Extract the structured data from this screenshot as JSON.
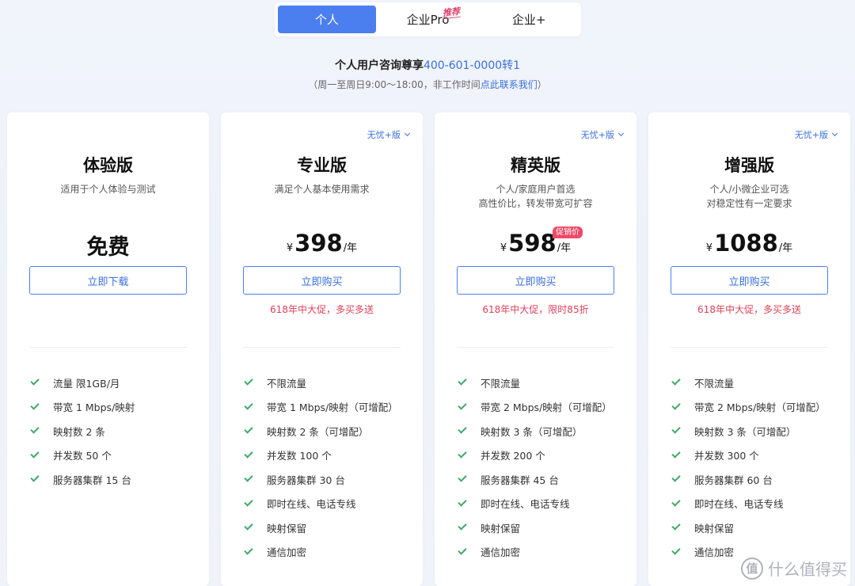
{
  "tabs": [
    {
      "label": "个人",
      "active": true
    },
    {
      "label": "企业Pro",
      "tag": "推荐"
    },
    {
      "label": "企业+"
    }
  ],
  "contact": {
    "text": "个人用户咨询尊享",
    "phone": "400-601-0000转1",
    "hours": "（周一至周日9:00～18:00，非工作时间",
    "link": "点此联系我们",
    "close": "）"
  },
  "plans": [
    {
      "variant": "",
      "title": "体验版",
      "desc": [
        "适用于个人体验与测试"
      ],
      "free_text": "免费",
      "currency": "",
      "amount": "",
      "unit": "",
      "badge": "",
      "button": "立即下载",
      "promo": "",
      "features": [
        "流量 限1GB/月",
        "带宽 1 Mbps/映射",
        "映射数 2 条",
        "并发数 50 个",
        "服务器集群 15 台"
      ]
    },
    {
      "variant": "无忧+版",
      "title": "专业版",
      "desc": [
        "满足个人基本使用需求"
      ],
      "free_text": "",
      "currency": "¥",
      "amount": "398",
      "unit": "/年",
      "badge": "",
      "button": "立即购买",
      "promo": "618年中大促，多买多送",
      "features": [
        "不限流量",
        "带宽 1 Mbps/映射（可增配）",
        "映射数 2 条（可增配）",
        "并发数 100 个",
        "服务器集群 30 台",
        "即时在线、电话专线",
        "映射保留",
        "通信加密"
      ]
    },
    {
      "variant": "无忧+版",
      "title": "精英版",
      "desc": [
        "个人/家庭用户首选",
        "高性价比，转发带宽可扩容"
      ],
      "free_text": "",
      "currency": "¥",
      "amount": "598",
      "unit": "/年",
      "badge": "促销价",
      "button": "立即购买",
      "promo": "618年中大促，限时85折",
      "features": [
        "不限流量",
        "带宽 2 Mbps/映射（可增配）",
        "映射数 3 条（可增配）",
        "并发数 200 个",
        "服务器集群 45 台",
        "即时在线、电话专线",
        "映射保留",
        "通信加密"
      ]
    },
    {
      "variant": "无忧+版",
      "title": "增强版",
      "desc": [
        "个人/小微企业可选",
        "对稳定性有一定要求"
      ],
      "free_text": "",
      "currency": "¥",
      "amount": "1088",
      "unit": "/年",
      "badge": "",
      "button": "立即购买",
      "promo": "618年中大促，多买多送",
      "features": [
        "不限流量",
        "带宽 2 Mbps/映射（可增配）",
        "映射数 3 条（可增配）",
        "并发数 300 个",
        "服务器集群 60 台",
        "即时在线、电话专线",
        "映射保留",
        "通信加密"
      ]
    }
  ],
  "watermark": {
    "logo": "值",
    "text": "什么值得买"
  }
}
